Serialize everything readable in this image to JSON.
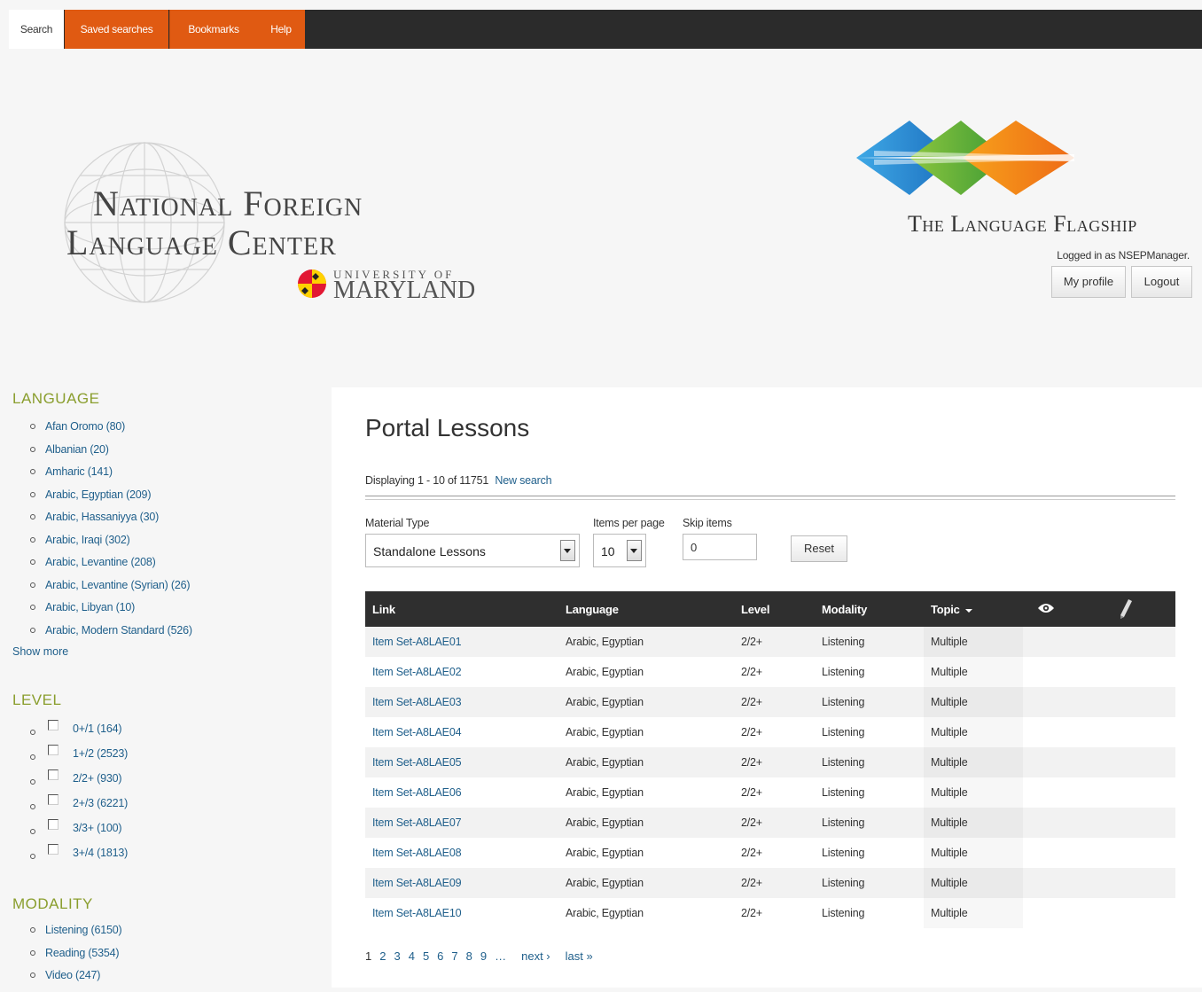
{
  "nav": {
    "tabs": [
      {
        "label": "Search"
      },
      {
        "label": "Saved searches"
      },
      {
        "label": "Bookmarks"
      },
      {
        "label": "Help"
      }
    ]
  },
  "header": {
    "nflc_line1": "National Foreign",
    "nflc_line2": "Language Center",
    "umd_small": "UNIVERSITY OF",
    "umd_big": "MARYLAND",
    "flagship_title": "The Language Flagship",
    "logged_in": "Logged in as NSEPManager.",
    "my_profile": "My profile",
    "logout": "Logout"
  },
  "sidebar": {
    "language_title": "LANGUAGE",
    "languages": [
      "Afan Oromo (80)",
      "Albanian (20)",
      "Amharic (141)",
      "Arabic, Egyptian (209)",
      "Arabic, Hassaniyya (30)",
      "Arabic, Iraqi (302)",
      "Arabic, Levantine (208)",
      "Arabic, Levantine (Syrian) (26)",
      "Arabic, Libyan (10)",
      "Arabic, Modern Standard (526)"
    ],
    "show_more": "Show more",
    "level_title": "LEVEL",
    "levels": [
      "0+/1 (164)",
      "1+/2 (2523)",
      "2/2+ (930)",
      "2+/3 (6221)",
      "3/3+ (100)",
      "3+/4 (1813)"
    ],
    "modality_title": "MODALITY",
    "modalities": [
      "Listening (6150)",
      "Reading (5354)",
      "Video (247)"
    ]
  },
  "main": {
    "title": "Portal Lessons",
    "displaying": "Displaying 1 - 10 of 11751",
    "new_search": "New search",
    "material_type_label": "Material Type",
    "material_type_value": "Standalone Lessons",
    "items_per_page_label": "Items per page",
    "items_per_page_value": "10",
    "skip_items_label": "Skip items",
    "skip_items_value": "0",
    "reset": "Reset"
  },
  "table": {
    "headers": {
      "link": "Link",
      "language": "Language",
      "level": "Level",
      "modality": "Modality",
      "topic": "Topic",
      "view_icon": "eye-icon",
      "edit_icon": "pencil-icon"
    },
    "rows": [
      {
        "link": "Item Set-A8LAE01",
        "language": "Arabic, Egyptian",
        "level": "2/2+",
        "modality": "Listening",
        "topic": "Multiple"
      },
      {
        "link": "Item Set-A8LAE02",
        "language": "Arabic, Egyptian",
        "level": "2/2+",
        "modality": "Listening",
        "topic": "Multiple"
      },
      {
        "link": "Item Set-A8LAE03",
        "language": "Arabic, Egyptian",
        "level": "2/2+",
        "modality": "Listening",
        "topic": "Multiple"
      },
      {
        "link": "Item Set-A8LAE04",
        "language": "Arabic, Egyptian",
        "level": "2/2+",
        "modality": "Listening",
        "topic": "Multiple"
      },
      {
        "link": "Item Set-A8LAE05",
        "language": "Arabic, Egyptian",
        "level": "2/2+",
        "modality": "Listening",
        "topic": "Multiple"
      },
      {
        "link": "Item Set-A8LAE06",
        "language": "Arabic, Egyptian",
        "level": "2/2+",
        "modality": "Listening",
        "topic": "Multiple"
      },
      {
        "link": "Item Set-A8LAE07",
        "language": "Arabic, Egyptian",
        "level": "2/2+",
        "modality": "Listening",
        "topic": "Multiple"
      },
      {
        "link": "Item Set-A8LAE08",
        "language": "Arabic, Egyptian",
        "level": "2/2+",
        "modality": "Listening",
        "topic": "Multiple"
      },
      {
        "link": "Item Set-A8LAE09",
        "language": "Arabic, Egyptian",
        "level": "2/2+",
        "modality": "Listening",
        "topic": "Multiple"
      },
      {
        "link": "Item Set-A8LAE10",
        "language": "Arabic, Egyptian",
        "level": "2/2+",
        "modality": "Listening",
        "topic": "Multiple"
      }
    ]
  },
  "pager": {
    "pages": [
      "1",
      "2",
      "3",
      "4",
      "5",
      "6",
      "7",
      "8",
      "9",
      "…"
    ],
    "next": "next ›",
    "last": "last »"
  },
  "colors": {
    "nav_bg": "#2b2b2b",
    "tab_orange": "#e05a12",
    "facet_title": "#8a9e2e",
    "link": "#1f5f8b"
  }
}
